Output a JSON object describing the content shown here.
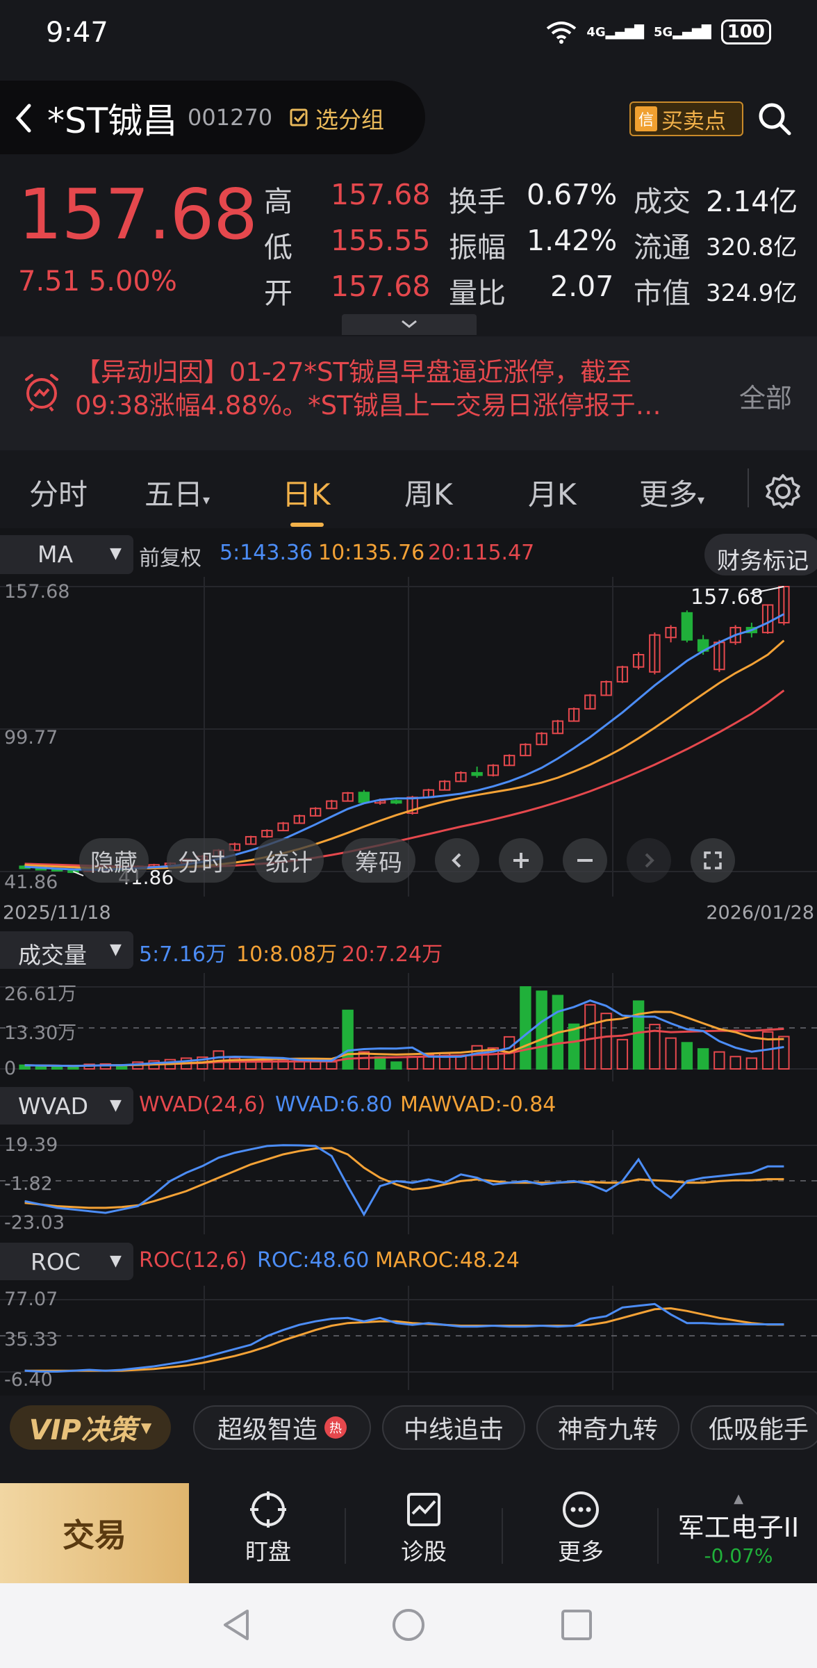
{
  "status_bar": {
    "time": "9:47",
    "signal_labels": [
      "4G",
      "5G"
    ],
    "battery": "100"
  },
  "header": {
    "stock_name": "*ST铖昌",
    "stock_code": "001270",
    "group_label": "选分组",
    "signal_badge": "信",
    "signal_label": "买卖点"
  },
  "quote": {
    "price": "157.68",
    "change": "7.51",
    "change_pct": "5.00%",
    "rows": [
      {
        "l1": "高",
        "v1": "157.68",
        "l2": "换手",
        "v2": "0.67%",
        "l3": "成交",
        "v3": "2.14亿"
      },
      {
        "l1": "低",
        "v1": "155.55",
        "l2": "振幅",
        "v2": "1.42%",
        "l3": "流通",
        "v3": "320.8亿"
      },
      {
        "l1": "开",
        "v1": "157.68",
        "l2": "量比",
        "v2": "2.07",
        "l3": "市值",
        "v3": "324.9亿"
      }
    ]
  },
  "news": {
    "line1": "【异动归因】01-27*ST铖昌早盘逼近涨停，截至",
    "line2": "09:38涨幅4.88%。*ST铖昌上一交易日涨停报于…",
    "all_label": "全部"
  },
  "tabs": [
    "分时",
    "五日",
    "日K",
    "周K",
    "月K",
    "更多"
  ],
  "active_tab": "日K",
  "kline": {
    "indicator": "MA",
    "adjust": "前复权",
    "ma5": "5:143.36",
    "ma10": "10:135.76",
    "ma20": "20:115.47",
    "fin_marks": "财务标记",
    "y_high": "157.68",
    "y_mid": "99.77",
    "y_low": "41.86",
    "low_marker": "41.86",
    "high_marker": "157.68",
    "date_start": "2025/11/18",
    "date_end": "2026/01/28",
    "tools": [
      "隐藏",
      "分时",
      "统计",
      "筹码"
    ]
  },
  "volume": {
    "label": "成交量",
    "ma5": "5:7.16万",
    "ma10": "10:8.08万",
    "ma20": "20:7.24万",
    "y_high": "26.61万",
    "y_mid": "13.30万",
    "y_low": "0"
  },
  "wvad": {
    "label": "WVAD",
    "param": "WVAD(24,6)",
    "value": "WVAD:6.80",
    "ma": "MAWVAD:-0.84",
    "y_high": "19.39",
    "y_mid": "-1.82",
    "y_low": "-23.03"
  },
  "roc": {
    "label": "ROC",
    "param": "ROC(12,6)",
    "value": "ROC:48.60",
    "ma": "MAROC:48.24",
    "y_high": "77.07",
    "y_mid": "35.33",
    "y_low": "-6.40"
  },
  "strategy": {
    "vip": "VIP决策",
    "chips": [
      "超级智造",
      "中线追击",
      "神奇九转",
      "低吸能手"
    ],
    "hot": "热"
  },
  "bottom_nav": {
    "trade": "交易",
    "items": [
      "盯盘",
      "诊股",
      "更多"
    ],
    "sector_name": "军工电子II",
    "sector_change": "-0.07%"
  },
  "colors": {
    "up": "#e5484d",
    "down": "#20b03a",
    "ma5": "#4c8df6",
    "ma10": "#f4a236",
    "ma20": "#e5484d",
    "accent": "#f2b14a"
  },
  "chart_data": {
    "type": "candlestick",
    "ylim": [
      41.86,
      157.68
    ],
    "candles": [
      {
        "o": 44.0,
        "c": 43.5,
        "h": 44.6,
        "l": 43.0,
        "up": false
      },
      {
        "o": 43.4,
        "c": 43.0,
        "h": 43.9,
        "l": 42.6,
        "up": false
      },
      {
        "o": 43.0,
        "c": 42.4,
        "h": 43.4,
        "l": 42.0,
        "up": false
      },
      {
        "o": 42.4,
        "c": 42.0,
        "h": 42.8,
        "l": 41.86,
        "up": false
      },
      {
        "o": 42.0,
        "c": 42.8,
        "h": 43.2,
        "l": 41.9,
        "up": true
      },
      {
        "o": 42.8,
        "c": 43.3,
        "h": 43.8,
        "l": 42.6,
        "up": true
      },
      {
        "o": 43.3,
        "c": 43.0,
        "h": 43.9,
        "l": 42.8,
        "up": false
      },
      {
        "o": 43.0,
        "c": 44.0,
        "h": 44.4,
        "l": 42.9,
        "up": true
      },
      {
        "o": 44.0,
        "c": 44.6,
        "h": 45.0,
        "l": 43.8,
        "up": true
      },
      {
        "o": 44.6,
        "c": 45.2,
        "h": 45.6,
        "l": 44.4,
        "up": true
      },
      {
        "o": 45.2,
        "c": 46.8,
        "h": 47.2,
        "l": 45.0,
        "up": true
      },
      {
        "o": 46.8,
        "c": 48.0,
        "h": 48.6,
        "l": 46.5,
        "up": true
      },
      {
        "o": 48.0,
        "c": 50.5,
        "h": 51.0,
        "l": 47.8,
        "up": true
      },
      {
        "o": 50.5,
        "c": 53.0,
        "h": 53.6,
        "l": 50.3,
        "up": true
      },
      {
        "o": 53.0,
        "c": 56.0,
        "h": 56.4,
        "l": 52.8,
        "up": true
      },
      {
        "o": 56.0,
        "c": 58.5,
        "h": 59.0,
        "l": 55.6,
        "up": true
      },
      {
        "o": 58.5,
        "c": 61.5,
        "h": 62.0,
        "l": 58.3,
        "up": true
      },
      {
        "o": 61.5,
        "c": 64.5,
        "h": 65.0,
        "l": 61.3,
        "up": true
      },
      {
        "o": 64.5,
        "c": 67.5,
        "h": 68.0,
        "l": 64.3,
        "up": true
      },
      {
        "o": 67.5,
        "c": 70.5,
        "h": 71.0,
        "l": 67.2,
        "up": true
      },
      {
        "o": 70.5,
        "c": 73.8,
        "h": 74.2,
        "l": 70.3,
        "up": true
      },
      {
        "o": 74.0,
        "c": 70.0,
        "h": 75.0,
        "l": 69.4,
        "up": false
      },
      {
        "o": 70.0,
        "c": 70.6,
        "h": 71.5,
        "l": 69.0,
        "up": true
      },
      {
        "o": 70.6,
        "c": 69.8,
        "h": 71.2,
        "l": 69.2,
        "up": false
      },
      {
        "o": 65.6,
        "c": 72.0,
        "h": 72.6,
        "l": 65.0,
        "up": true
      },
      {
        "o": 72.0,
        "c": 75.0,
        "h": 75.5,
        "l": 71.8,
        "up": true
      },
      {
        "o": 75.0,
        "c": 78.5,
        "h": 79.0,
        "l": 74.8,
        "up": true
      },
      {
        "o": 78.5,
        "c": 82.0,
        "h": 82.6,
        "l": 78.3,
        "up": true
      },
      {
        "o": 82.0,
        "c": 81.0,
        "h": 84.5,
        "l": 80.0,
        "up": false
      },
      {
        "o": 81.0,
        "c": 85.0,
        "h": 85.5,
        "l": 80.5,
        "up": true
      },
      {
        "o": 85.0,
        "c": 89.0,
        "h": 89.5,
        "l": 84.8,
        "up": true
      },
      {
        "o": 89.0,
        "c": 93.5,
        "h": 94.0,
        "l": 88.8,
        "up": true
      },
      {
        "o": 93.5,
        "c": 98.0,
        "h": 98.5,
        "l": 93.3,
        "up": true
      },
      {
        "o": 98.0,
        "c": 103.0,
        "h": 103.5,
        "l": 97.8,
        "up": true
      },
      {
        "o": 103.0,
        "c": 108.0,
        "h": 108.5,
        "l": 102.8,
        "up": true
      },
      {
        "o": 108.0,
        "c": 113.5,
        "h": 114.0,
        "l": 107.8,
        "up": true
      },
      {
        "o": 113.5,
        "c": 119.0,
        "h": 119.5,
        "l": 113.3,
        "up": true
      },
      {
        "o": 119.0,
        "c": 125.0,
        "h": 125.5,
        "l": 118.5,
        "up": true
      },
      {
        "o": 125.0,
        "c": 130.0,
        "h": 131.0,
        "l": 124.0,
        "up": true
      },
      {
        "o": 123.0,
        "c": 138.0,
        "h": 139.0,
        "l": 122.0,
        "up": true
      },
      {
        "o": 137.0,
        "c": 141.0,
        "h": 142.0,
        "l": 135.0,
        "up": true
      },
      {
        "o": 147.0,
        "c": 136.0,
        "h": 148.0,
        "l": 135.0,
        "up": false
      },
      {
        "o": 136.0,
        "c": 131.5,
        "h": 138.0,
        "l": 130.0,
        "up": false
      },
      {
        "o": 124.0,
        "c": 135.0,
        "h": 136.0,
        "l": 123.0,
        "up": true
      },
      {
        "o": 135.0,
        "c": 141.0,
        "h": 142.0,
        "l": 134.0,
        "up": true
      },
      {
        "o": 141.0,
        "c": 139.0,
        "h": 143.0,
        "l": 137.0,
        "up": false
      },
      {
        "o": 139.0,
        "c": 150.2,
        "h": 150.5,
        "l": 138.5,
        "up": true
      },
      {
        "o": 143.0,
        "c": 157.68,
        "h": 157.68,
        "l": 142.0,
        "up": true
      }
    ],
    "ma5": [
      43.8,
      43.4,
      43.0,
      42.7,
      42.6,
      42.7,
      42.9,
      43.2,
      43.6,
      44.0,
      44.8,
      45.8,
      47.0,
      48.6,
      50.5,
      52.6,
      55.0,
      58.0,
      61.0,
      64.2,
      67.3,
      69.6,
      71.0,
      71.6,
      71.6,
      72.0,
      72.7,
      73.5,
      74.8,
      76.5,
      78.5,
      81.0,
      84.0,
      87.8,
      92.0,
      96.5,
      101.5,
      106.5,
      112.0,
      117.5,
      122.5,
      127.5,
      131.5,
      135.0,
      138.0,
      140.0,
      143.0,
      146.5
    ],
    "ma10": [
      44.5,
      44.2,
      43.9,
      43.6,
      43.3,
      43.2,
      43.1,
      43.1,
      43.2,
      43.4,
      43.7,
      44.1,
      44.7,
      45.5,
      46.5,
      47.8,
      49.3,
      51.0,
      53.0,
      55.2,
      57.6,
      60.1,
      62.5,
      64.8,
      66.8,
      68.7,
      70.4,
      71.8,
      73.0,
      74.1,
      75.2,
      76.5,
      78.0,
      80.0,
      82.5,
      85.3,
      88.5,
      92.0,
      96.0,
      100.3,
      104.8,
      109.5,
      114.0,
      118.5,
      122.5,
      126.0,
      130.0,
      135.76
    ],
    "ma20": [
      45.0,
      44.8,
      44.6,
      44.4,
      44.2,
      44.0,
      43.9,
      43.8,
      43.7,
      43.7,
      43.7,
      43.8,
      44.0,
      44.3,
      44.7,
      45.2,
      45.8,
      46.6,
      47.5,
      48.6,
      49.8,
      51.2,
      52.6,
      54.1,
      55.6,
      57.1,
      58.6,
      60.1,
      61.5,
      63.0,
      64.6,
      66.3,
      68.1,
      70.1,
      72.2,
      74.5,
      77.0,
      79.6,
      82.4,
      85.3,
      88.4,
      91.6,
      95.0,
      98.5,
      102.2,
      106.0,
      110.5,
      115.47
    ],
    "volume": {
      "ylim": [
        0,
        26.61
      ],
      "bars": [
        1.2,
        1.0,
        0.9,
        0.8,
        1.5,
        1.6,
        1.3,
        2.2,
        2.6,
        3.0,
        3.5,
        3.8,
        5.8,
        3.6,
        2.5,
        2.7,
        3.0,
        2.8,
        2.5,
        2.3,
        19.0,
        5.5,
        3.9,
        2.2,
        4.0,
        4.5,
        5.0,
        4.2,
        7.5,
        6.8,
        10.4,
        26.6,
        25.2,
        23.8,
        14.5,
        20.8,
        18.0,
        9.5,
        22.0,
        14.4,
        10.0,
        8.5,
        6.5,
        5.5,
        4.0,
        3.5,
        12.0,
        10.5
      ],
      "up_flags": [
        false,
        false,
        false,
        false,
        true,
        true,
        false,
        true,
        true,
        true,
        true,
        true,
        true,
        true,
        true,
        true,
        true,
        true,
        true,
        true,
        false,
        true,
        false,
        false,
        true,
        true,
        true,
        true,
        true,
        true,
        true,
        false,
        false,
        false,
        false,
        true,
        true,
        true,
        false,
        true,
        true,
        false,
        false,
        true,
        true,
        true,
        true,
        true
      ]
    },
    "wvad": {
      "ylim": [
        -23.03,
        19.39
      ],
      "wvad": [
        -14,
        -16,
        -18,
        -19,
        -20,
        -21,
        -19,
        -17,
        -10,
        -2,
        3,
        7,
        12,
        15,
        17,
        19,
        19.5,
        19.4,
        19,
        13,
        -5,
        -22,
        -5,
        -2,
        -3,
        -1,
        -3,
        2,
        0,
        -4,
        -3,
        -2,
        -4,
        -3,
        -2,
        -4,
        -8,
        -2,
        11,
        -5,
        -12,
        -2,
        0,
        1,
        2,
        3,
        6.8,
        6.8
      ],
      "mawvad": [
        -15,
        -16,
        -17,
        -17.5,
        -18,
        -18,
        -17.5,
        -16.5,
        -14,
        -11,
        -8,
        -4,
        0,
        4,
        8,
        11,
        14,
        16,
        17.5,
        17.8,
        14,
        6,
        0,
        -4,
        -7,
        -6,
        -4,
        -2,
        -1,
        -2,
        -3,
        -3,
        -3,
        -3,
        -2.5,
        -2.5,
        -3,
        -3,
        -1,
        -1.5,
        -2,
        -3,
        -3,
        -2,
        -1.5,
        -1.5,
        -0.84,
        -0.84
      ]
    },
    "roc": {
      "ylim": [
        -6.4,
        77.07
      ],
      "roc": [
        -5,
        -6,
        -6,
        -5,
        -4,
        -5,
        -4,
        -2,
        0,
        3,
        6,
        10,
        15,
        20,
        25,
        35,
        42,
        48,
        52,
        55,
        56,
        52,
        56,
        50,
        48,
        50,
        48,
        46,
        46,
        47,
        46,
        46,
        47,
        46,
        47,
        55,
        58,
        68,
        70,
        72,
        60,
        50,
        50,
        49,
        49,
        48.6,
        48.6,
        48.6
      ],
      "maroc": [
        -5,
        -5,
        -5,
        -5,
        -5,
        -5,
        -5,
        -4,
        -3,
        -1,
        1,
        4,
        8,
        12,
        17,
        23,
        30,
        36,
        42,
        47,
        50,
        51,
        52,
        52,
        50,
        49,
        48,
        47,
        47,
        47,
        47,
        47,
        47,
        47,
        47,
        48,
        51,
        56,
        61,
        66,
        67,
        64,
        60,
        56,
        53,
        50,
        48.24,
        48.24
      ]
    }
  }
}
